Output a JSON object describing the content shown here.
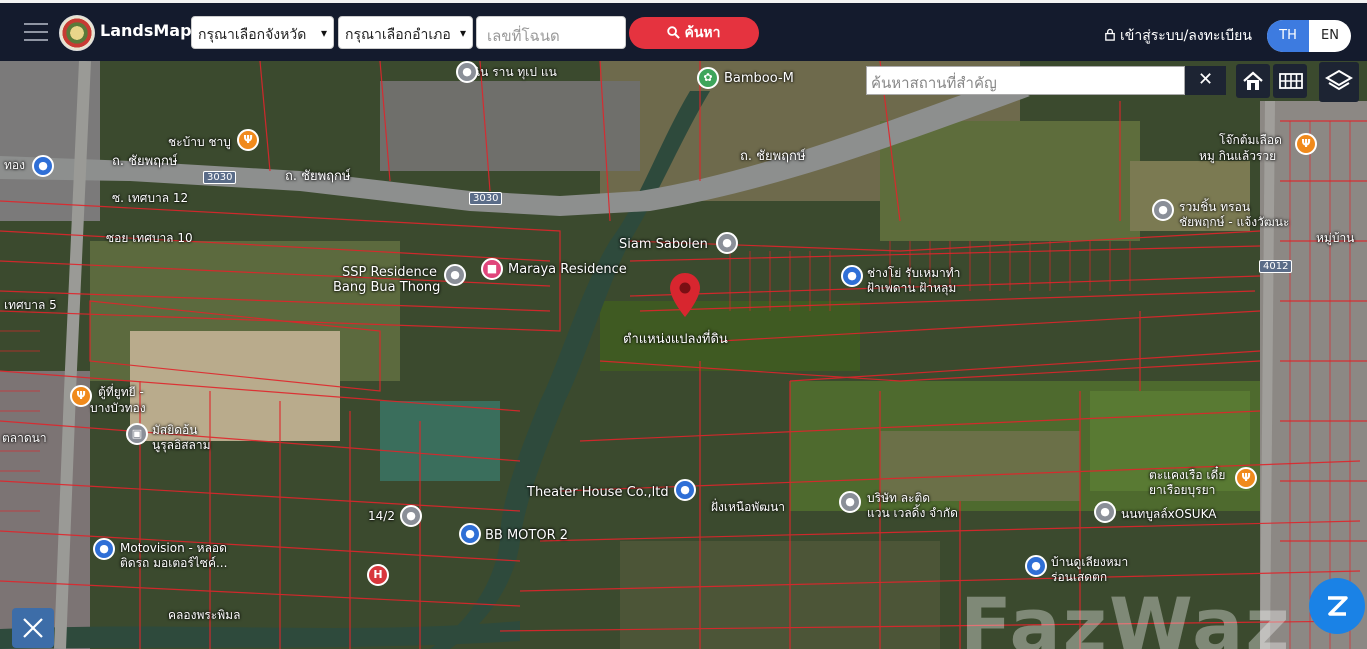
{
  "header": {
    "brand": "LandsMaps",
    "province_select": "กรุณาเลือกจังหวัด",
    "district_select": "กรุณาเลือกอำเภอ",
    "deed_placeholder": "เลขที่โฉนด",
    "search_label": "ค้นหา",
    "login_label": "เข้าสู่ระบบ/ลงทะเบียน",
    "lang_th": "TH",
    "lang_en": "EN"
  },
  "map_controls": {
    "place_search_placeholder": "ค้นหาสถานที่สำคัญ",
    "clear_symbol": "✕",
    "watermark": "FazWaz"
  },
  "map_labels": {
    "road_main_1": "ถ. ชัยพฤกษ์",
    "road_main_2": "ถ. ชัยพฤกษ์",
    "road_main_3": "ถ. ชัยพฤกษ์",
    "route_3030a": "3030",
    "route_3030b": "3030",
    "route_4012": "4012",
    "soi_12": "ซ. เทศบาล 12",
    "soi_10": "ซอย เทศบาล 10",
    "soi_5": "เทศบาล 5",
    "bamboo": "Bamboo-M",
    "top_temple": "ฉิน ราน ทุเป แน",
    "chabu": "ชะบ้าบ ชาบู",
    "siam_sabolen": "Siam Sabolen",
    "ssp_residence_1": "SSP Residence",
    "ssp_residence_2": "Bang Bua Thong",
    "maraya": "Maraya Residence",
    "parcel_position": "ตำแหน่งแปลงที่ดิน",
    "chang_yo": "ช่างโย่ รับเหมาทำ",
    "chang_yo_2": "ฝ้าเพดาน ฝ้าหลุม",
    "jikmoo": "โจ๊กต้มเลือด",
    "jikmoo_2": "หมู กินแล้วรวย",
    "ruamchai": "รวมชิ้น ทรอน",
    "ruamchai_2": "ชัยพฤกษ์ - แจ้งวัฒนะ",
    "moo_ban": "หมู่บ้าน",
    "theater": "Theater House Co.,ltd",
    "fai_nuea": "ฝั่งเหนือพัฒนา",
    "company": "บริษัท ละติด",
    "company_2": "แวน เวลดิ้ง จำกัด",
    "bb_motor": "BB MOTOR 2",
    "num_142": "14/2",
    "motovision": "Motovision - หลอด",
    "motovision_2": "ติดรถ มอเตอร์ไซค์...",
    "tokyo": "ตู้ที่ยูทยี -",
    "tokyo_2": "บางบัวทอง",
    "mosque": "มัสยิดอ้น",
    "mosque_2": "นูรุลอิสลาม",
    "talad": "ตลาดนา",
    "dangkriang": "ตะแคงเรือ เดี๋ย",
    "dangkriang_2": "ยาเรือยบุรยา",
    "osuka": "นนทบูลล์xOSUKA",
    "ban_dung": "บ้านดูเลียงหมา",
    "ban_dung_2": "ร่อนเสดตก",
    "tong": "ทอง",
    "klong": "คลองพระพิมล"
  }
}
